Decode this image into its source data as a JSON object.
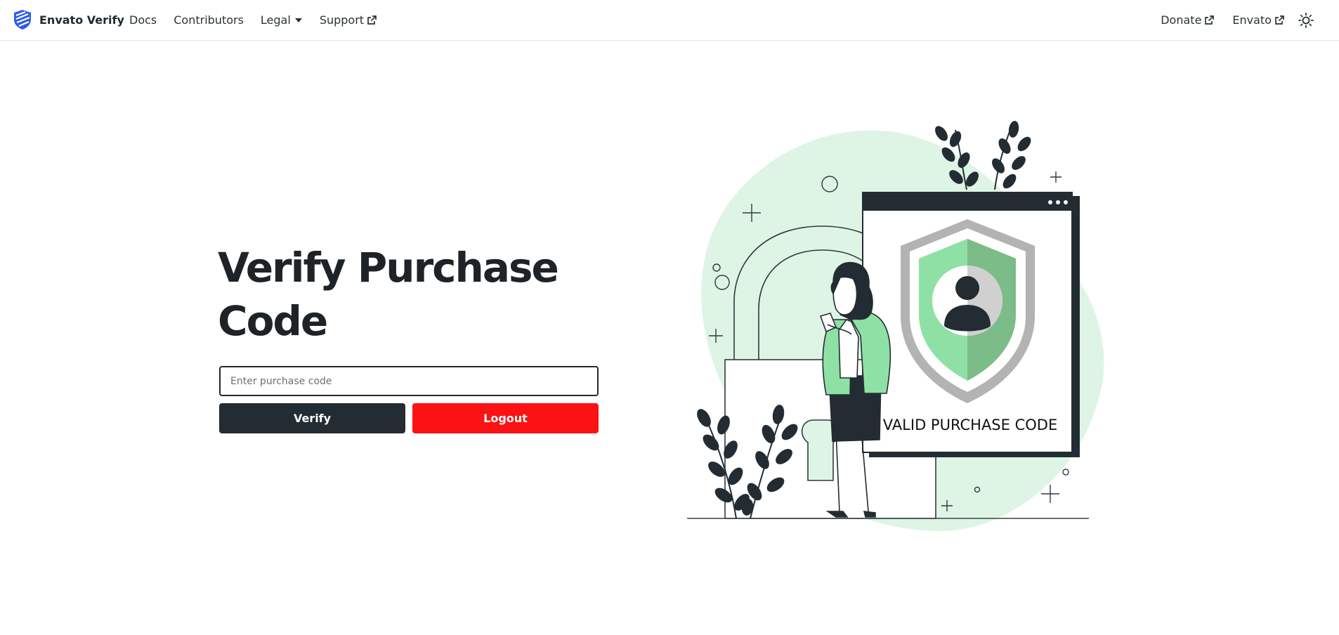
{
  "brand": {
    "name": "Envato Verify",
    "icon": "shield-logo-icon"
  },
  "nav": {
    "left": [
      {
        "label": "Docs"
      },
      {
        "label": "Contributors"
      },
      {
        "label": "Legal",
        "icon": "caret-down-icon"
      },
      {
        "label": "Support",
        "icon": "external-link-icon"
      }
    ],
    "right": [
      {
        "label": "Donate",
        "icon": "external-link-icon"
      },
      {
        "label": "Envato",
        "icon": "external-link-icon"
      }
    ],
    "theme_icon": "sun-icon"
  },
  "hero": {
    "title": "Verify Purchase Code",
    "input": {
      "placeholder": "Enter purchase code",
      "value": ""
    },
    "verify_label": "Verify",
    "logout_label": "Logout"
  },
  "illustration": {
    "caption": "VALID PURCHASE CODE"
  },
  "colors": {
    "dark": "#232c33",
    "danger": "#fc1212",
    "mint": "#def5e5",
    "shield_green": "#8fe0a5",
    "brand_blue": "#2f5bea"
  }
}
